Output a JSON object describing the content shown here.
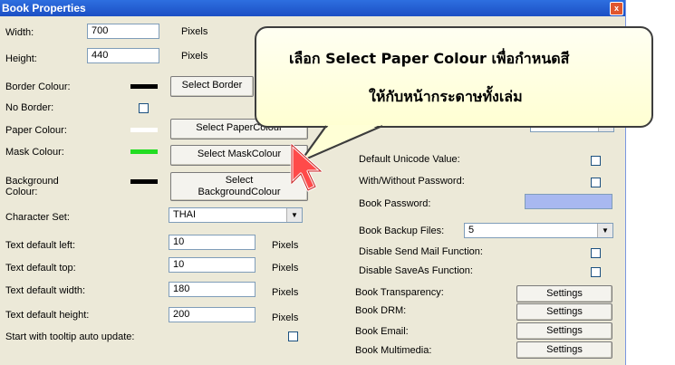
{
  "window": {
    "title": "Book Properties",
    "close_glyph": "x"
  },
  "left": {
    "width_label": "Width:",
    "width_value": "700",
    "width_unit": "Pixels",
    "height_label": "Height:",
    "height_value": "440",
    "height_unit": "Pixels",
    "border_colour_label": "Border Colour:",
    "border_colour": "#000000",
    "select_border_button": "Select Border",
    "no_border_label": "No Border:",
    "paper_colour_label": "Paper Colour:",
    "paper_colour": "#ffffff",
    "select_paper_button": "Select PaperColour",
    "mask_colour_label": "Mask Colour:",
    "mask_colour": "#22dd22",
    "select_mask_button": "Select MaskColour",
    "background_colour_label": "Background Colour:",
    "background_colour": "#000000",
    "select_background_button_line1": "Select",
    "select_background_button_line2": "BackgroundColour",
    "character_set_label": "Character Set:",
    "character_set_value": "THAI",
    "text_left_label": "Text default left:",
    "text_left_value": "10",
    "text_left_unit": "Pixels",
    "text_top_label": "Text default top:",
    "text_top_value": "10",
    "text_top_unit": "Pixels",
    "text_width_label": "Text default width:",
    "text_width_value": "180",
    "text_width_unit": "Pixels",
    "text_height_label": "Text default height:",
    "text_height_value": "200",
    "text_height_unit": "Pixels",
    "tooltip_label": "Start with tooltip auto update:"
  },
  "right": {
    "default_unicode_label": "Default Unicode Value:",
    "with_without_password_label": "With/Without Password:",
    "book_password_label": "Book Password:",
    "book_backup_label": "Book Backup Files:",
    "book_backup_value": "5",
    "disable_send_mail_label": "Disable Send Mail Function:",
    "disable_saveas_label": "Disable SaveAs Function:",
    "book_transparency_label": "Book Transparency:",
    "book_drm_label": "Book DRM:",
    "book_email_label": "Book Email:",
    "book_multimedia_label": "Book Multimedia:",
    "settings_label": "Settings"
  },
  "callout": {
    "line1": "เลือก Select Paper Colour เพื่อกำหนดสี",
    "line2": "ให้กับหน้ากระดาษทั้งเล่ม"
  },
  "colors": {
    "accent": "#1c4fc4",
    "password_field": "#a8b8f0",
    "cursor_red": "#ff4040"
  },
  "icons": {
    "cursor": "mouse-pointer-icon",
    "dropdown": "chevron-down-icon",
    "close": "close-icon"
  }
}
